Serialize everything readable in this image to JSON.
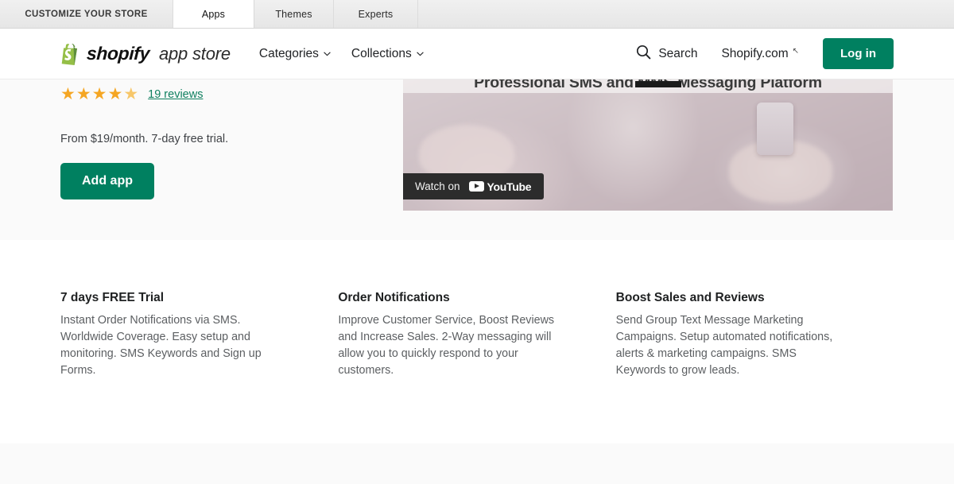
{
  "browser_tabs": {
    "items": [
      {
        "label": "CUSTOMIZE YOUR STORE",
        "active": false
      },
      {
        "label": "Apps",
        "active": true
      },
      {
        "label": "Themes",
        "active": false
      },
      {
        "label": "Experts",
        "active": false
      }
    ]
  },
  "header": {
    "brand": {
      "icon": "shopify-bag-icon",
      "word": "shopify",
      "sub": "app store"
    },
    "nav": [
      {
        "label": "Categories",
        "icon": "chevron-down-icon"
      },
      {
        "label": "Collections",
        "icon": "chevron-down-icon"
      }
    ],
    "search": {
      "icon": "search-icon",
      "label": "Search"
    },
    "shopify_com": {
      "label": "Shopify.com",
      "icon": "external-link-arrow-icon",
      "glyph": "↖"
    },
    "login_label": "Log in"
  },
  "hero": {
    "rating": {
      "stars_filled": 4,
      "stars_partial": 1,
      "star_glyph": "★",
      "reviews_label": "19 reviews",
      "reviews_count": 19
    },
    "pricing_text": "From $19/month. 7-day free trial.",
    "add_app_label": "Add app",
    "video": {
      "title": "Professional SMS and MMS Messaging Platform",
      "watch_on": "Watch on",
      "provider": "YouTube",
      "play_icon": "youtube-play-icon"
    }
  },
  "features": [
    {
      "title": "7 days FREE Trial",
      "body": "Instant Order Notifications via SMS. Worldwide Coverage. Easy setup and monitoring. SMS Keywords and Sign up Forms."
    },
    {
      "title": "Order Notifications",
      "body": "Improve Customer Service, Boost Reviews and Increase Sales. 2-Way messaging will allow you to quickly respond to your customers."
    },
    {
      "title": "Boost Sales and Reviews",
      "body": "Send Group Text Message Marketing Campaigns. Setup automated notifications, alerts & marketing campaigns. SMS Keywords to grow leads."
    }
  ],
  "colors": {
    "brand_green": "#008060",
    "link_green": "#108060",
    "star_gold": "#f5a623",
    "hero_bg": "#fafafa",
    "text_primary": "#202223",
    "text_secondary": "#5c5f62"
  }
}
